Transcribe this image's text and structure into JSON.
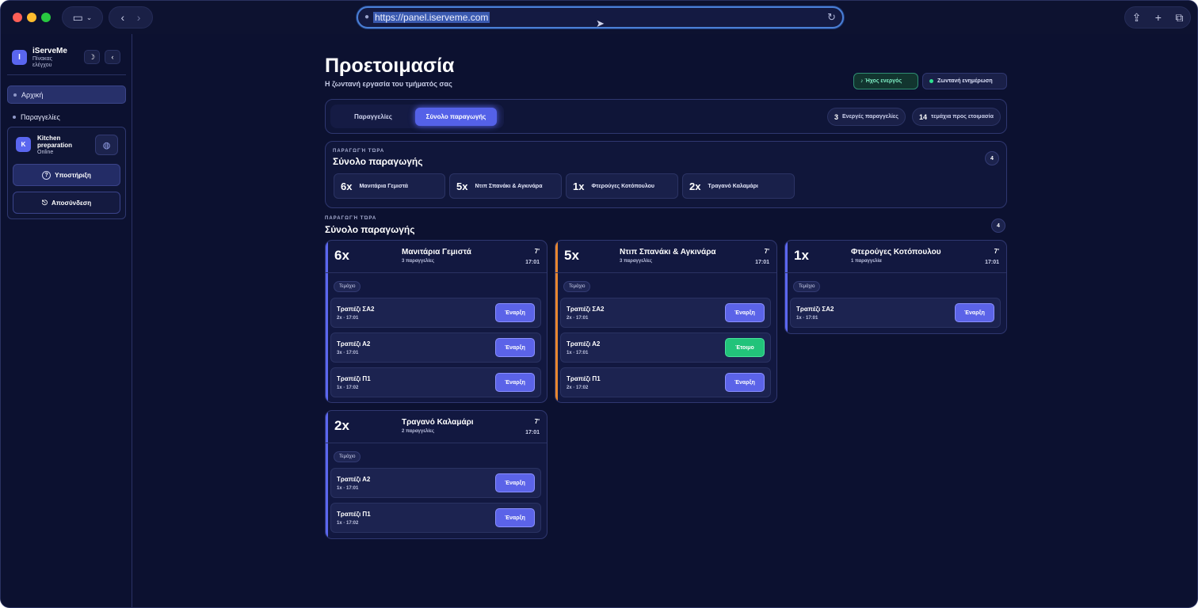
{
  "browser": {
    "url": "https://panel.iserveme.com"
  },
  "sidebar": {
    "brand": "iServeMe",
    "brand_sub": "Πίνακας ελέγχου",
    "logo_letter": "I",
    "theme_icon": "☽",
    "collapse_icon": "‹",
    "items": [
      {
        "label": "Αρχική"
      },
      {
        "label": "Παραγγελίες"
      }
    ],
    "kitchen": {
      "avatar": "K",
      "name": "Kitchen preparation",
      "status": "Online"
    },
    "support_label": "Υποστήριξη",
    "logout_label": "Αποσύνδεση"
  },
  "page": {
    "title": "Προετοιμασία",
    "subtitle": "Η ζωντανή εργασία του τμήματός σας",
    "sound_label": "♪ Ήχος ενεργός",
    "live_label": "Ζωντανή ενημέρωση"
  },
  "toolbar": {
    "tabs": [
      {
        "label": "Παραγγελίες"
      },
      {
        "label": "Σύνολο παραγωγής"
      }
    ],
    "active_orders_count": "3",
    "active_orders_label": "Ενεργές παραγγελίες",
    "items_count": "14",
    "items_label": "τεμάχια προς ετοιμασία"
  },
  "summary": {
    "eyebrow": "ΠΑΡΑΓΩΓΉ ΤΏΡΑ",
    "title": "Σύνολο παραγωγής",
    "count": "4",
    "chips": [
      {
        "qty": "6x",
        "name": "Μανιτάρια Γεμιστά"
      },
      {
        "qty": "5x",
        "name": "Ντιπ Σπανάκι & Αγκινάρα"
      },
      {
        "qty": "1x",
        "name": "Φτερούγες Κοτόπουλου"
      },
      {
        "qty": "2x",
        "name": "Τραγανό Καλαμάρι"
      }
    ]
  },
  "section": {
    "eyebrow": "ΠΑΡΑΓΩΓΉ ΤΏΡΑ",
    "title": "Σύνολο παραγωγής",
    "count": "4"
  },
  "cards": [
    {
      "qty": "6x",
      "name": "Μανιτάρια Γεμιστά",
      "orders": "3 παραγγελίες",
      "time": "7'",
      "clock": "17:01",
      "tag": "Τεμάχιο",
      "accent": "#5b67f0",
      "rows": [
        {
          "table": "Τραπέζι ΣΑ2",
          "sub": "2x · 17:01",
          "action": "Έναρξη"
        },
        {
          "table": "Τραπέζι Α2",
          "sub": "3x · 17:01",
          "action": "Έναρξη"
        },
        {
          "table": "Τραπέζι Π1",
          "sub": "1x · 17:02",
          "action": "Έναρξη"
        }
      ]
    },
    {
      "qty": "5x",
      "name": "Ντιπ Σπανάκι & Αγκινάρα",
      "orders": "3 παραγγελίες",
      "time": "7'",
      "clock": "17:01",
      "tag": "Τεμάχιο",
      "accent": "#e8872f",
      "rows": [
        {
          "table": "Τραπέζι ΣΑ2",
          "sub": "2x · 17:01",
          "action": "Έναρξη"
        },
        {
          "table": "Τραπέζι Α2",
          "sub": "1x · 17:01",
          "action": "Έτοιμο"
        },
        {
          "table": "Τραπέζι Π1",
          "sub": "2x · 17:02",
          "action": "Έναρξη"
        }
      ]
    },
    {
      "qty": "1x",
      "name": "Φτερούγες Κοτόπουλου",
      "orders": "1 παραγγελία",
      "time": "7'",
      "clock": "17:01",
      "tag": "Τεμάχιο",
      "accent": "#5b67f0",
      "rows": [
        {
          "table": "Τραπέζι ΣΑ2",
          "sub": "1x · 17:01",
          "action": "Έναρξη"
        }
      ]
    },
    {
      "qty": "2x",
      "name": "Τραγανό Καλαμάρι",
      "orders": "2 παραγγελίες",
      "time": "7'",
      "clock": "17:01",
      "tag": "Τεμάχιο",
      "accent": "#5b67f0",
      "rows": [
        {
          "table": "Τραπέζι Α2",
          "sub": "1x · 17:01",
          "action": "Έναρξη"
        },
        {
          "table": "Τραπέζι Π1",
          "sub": "1x · 17:02",
          "action": "Έναρξη"
        }
      ]
    }
  ]
}
